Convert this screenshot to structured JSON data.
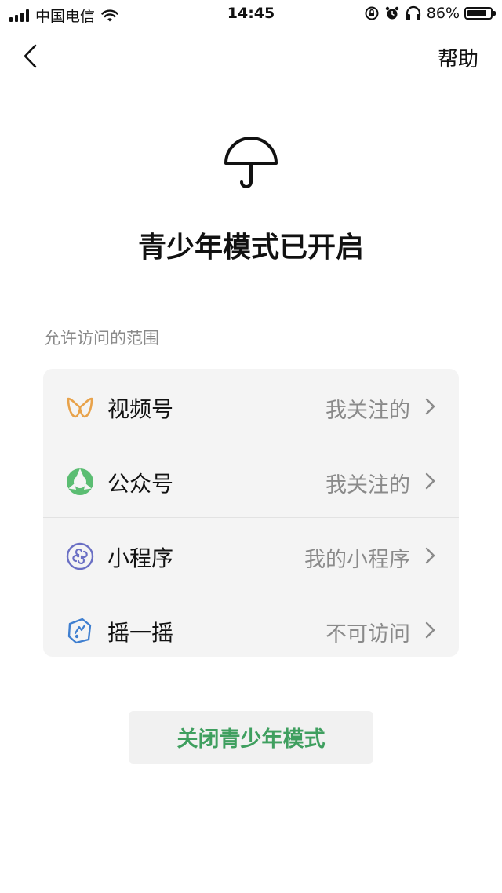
{
  "status_bar": {
    "carrier": "中国电信",
    "time": "14:45",
    "battery": "86%",
    "battery_level": 0.86,
    "icons": [
      "signal-icon",
      "wifi-icon",
      "orientation-lock-icon",
      "alarm-icon",
      "headphones-icon",
      "battery-icon"
    ]
  },
  "nav": {
    "back_icon": "chevron-left-icon",
    "help_label": "帮助"
  },
  "header": {
    "icon": "umbrella-icon",
    "title": "青少年模式已开启"
  },
  "section": {
    "label": "允许访问的范围"
  },
  "items": [
    {
      "icon": "channels-icon",
      "label": "视频号",
      "value": "我关注的",
      "color": "#e8a24a"
    },
    {
      "icon": "official-accounts-icon",
      "label": "公众号",
      "value": "我关注的",
      "color": "#5bbd72"
    },
    {
      "icon": "mini-program-icon",
      "label": "小程序",
      "value": "我的小程序",
      "color": "#6a6fc4"
    },
    {
      "icon": "shake-icon",
      "label": "摇一摇",
      "value": "不可访问",
      "color": "#3f7fd0"
    }
  ],
  "actions": {
    "close_label": "关闭青少年模式",
    "close_color": "#3f9f5f"
  }
}
